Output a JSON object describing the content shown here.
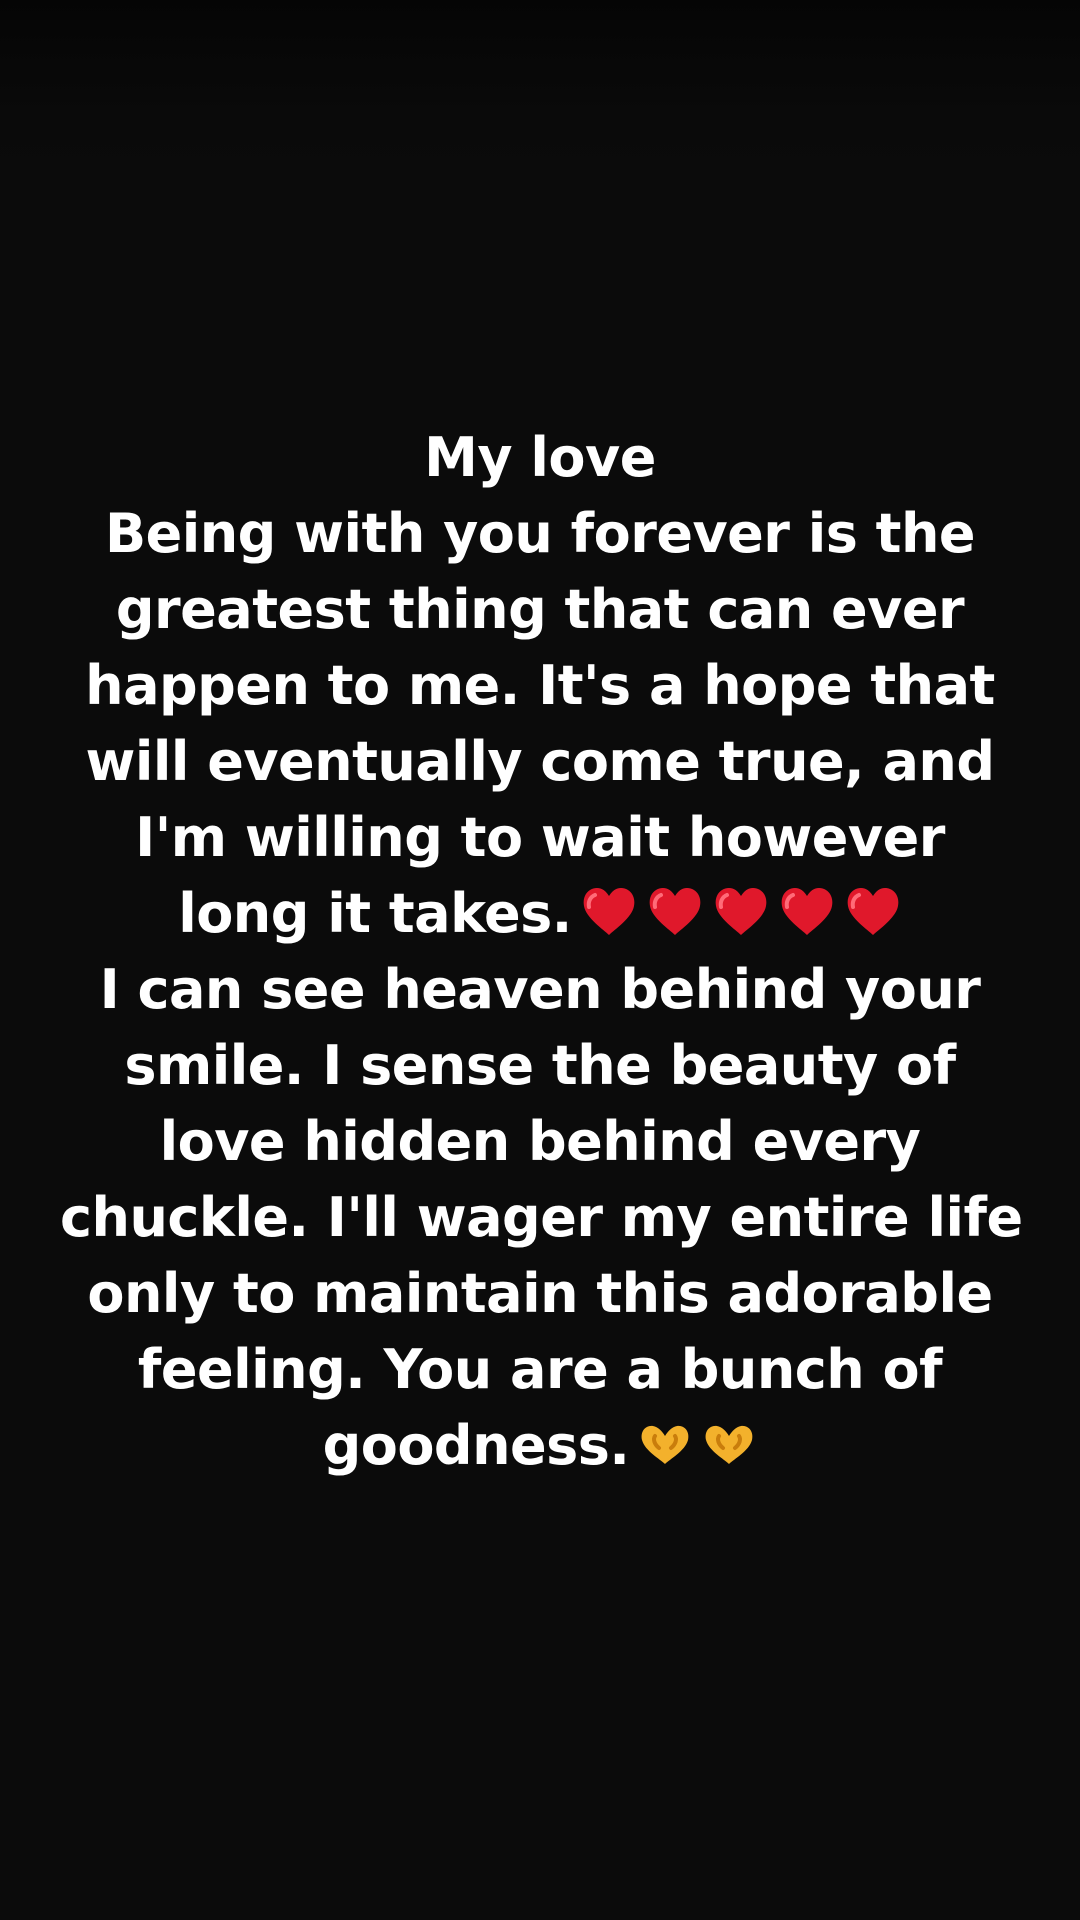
{
  "message": {
    "lines": [
      "My love",
      "Being with you forever is the",
      "greatest thing that can ever",
      "happen to me. It's a hope that",
      "will eventually come true, and",
      "I'm willing to wait however",
      "long it takes.",
      "I can see heaven behind your",
      "smile. I sense the beauty of",
      "love hidden behind every",
      "chuckle. I'll wager my entire life",
      "only to maintain this adorable",
      "feeling. You are a bunch of",
      "goodness."
    ],
    "emoji_after_line_7": {
      "icon": "red-heart-icon",
      "count": 5,
      "color": "#e0182b"
    },
    "emoji_after_line_14": {
      "icon": "heart-hands-icon",
      "count": 2,
      "color": "#f3b12c"
    }
  },
  "colors": {
    "background": "#0b0b0b",
    "text": "#ffffff"
  }
}
